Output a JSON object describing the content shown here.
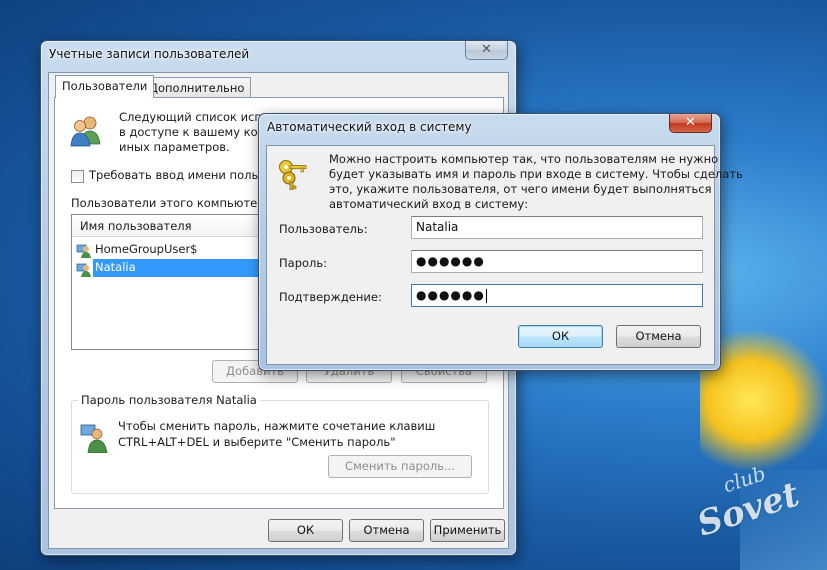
{
  "desktop": {
    "watermark_line1": "club",
    "watermark_line2": "Sovet"
  },
  "main_window": {
    "title": "Учетные записи пользователей",
    "close_symbol": "✕",
    "tabs": [
      {
        "label": "Пользователи",
        "active": true
      },
      {
        "label": "Дополнительно",
        "active": false
      }
    ],
    "intro_lines": [
      "Следующий список испо",
      "в доступе к вашему комп",
      "иных параметров."
    ],
    "require_password_label": "Требовать ввод имени пользов",
    "users_section_label": "Пользователи этого компьютера:",
    "column_header": "Имя пользователя",
    "users": [
      {
        "name": "HomeGroupUser$",
        "selected": false
      },
      {
        "name": "Natalia",
        "selected": true
      }
    ],
    "buttons": {
      "add": "Добавить",
      "remove": "Удалить",
      "properties": "Свойства"
    },
    "password_group_label": "Пароль пользователя Natalia",
    "password_hint_lines": [
      "Чтобы сменить пароль, нажмите сочетание клавиш",
      "CTRL+ALT+DEL и выберите \"Сменить пароль\""
    ],
    "change_password_button": "Сменить пароль...",
    "footer": {
      "ok": "ОК",
      "cancel": "Отмена",
      "apply": "Применить"
    }
  },
  "autologon_dialog": {
    "title": "Автоматический вход в систему",
    "close_symbol": "✕",
    "description_lines": [
      "Можно настроить компьютер так, что пользователям не нужно",
      "будет указывать имя и пароль при входе в систему. Чтобы сделать",
      "это, укажите пользователя, от чего имени будет выполняться",
      "автоматический вход в систему:"
    ],
    "fields": {
      "user_label": "Пользователь:",
      "user_value": "Natalia",
      "password_label": "Пароль:",
      "password_value": "●●●●●●",
      "confirm_label": "Подтверждение:",
      "confirm_value": "●●●●●●"
    },
    "ok": "ОК",
    "cancel": "Отмена"
  },
  "icons": {
    "users": "users-icon",
    "keys": "keys-icon",
    "user": "user-icon",
    "user_key": "user-key-icon"
  },
  "colors": {
    "selection": "#3399ff",
    "close_button": "#c7402a",
    "default_button": "#3c7fb1"
  }
}
